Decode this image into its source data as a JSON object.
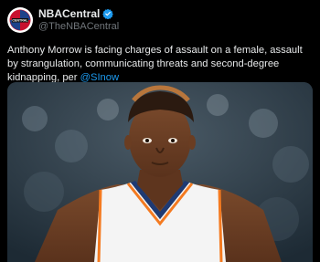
{
  "account": {
    "display_name": "NBACentral",
    "handle": "@TheNBACentral",
    "avatar_icon": "nba-central-logo",
    "verified_icon": "verified-badge-icon"
  },
  "tweet": {
    "text": "Anthony Morrow is facing charges of assault on a female, assault by strangulation, communicating threats and second-degree kidnapping, per ",
    "mention": "@SInow"
  },
  "media": {
    "description_icon": "player-photo"
  },
  "colors": {
    "background": "#000000",
    "text": "#e7e9ea",
    "secondary": "#71767b",
    "link": "#1d9bf0",
    "jersey_trim": "#f47a20",
    "jersey_navy": "#1e3a73"
  }
}
